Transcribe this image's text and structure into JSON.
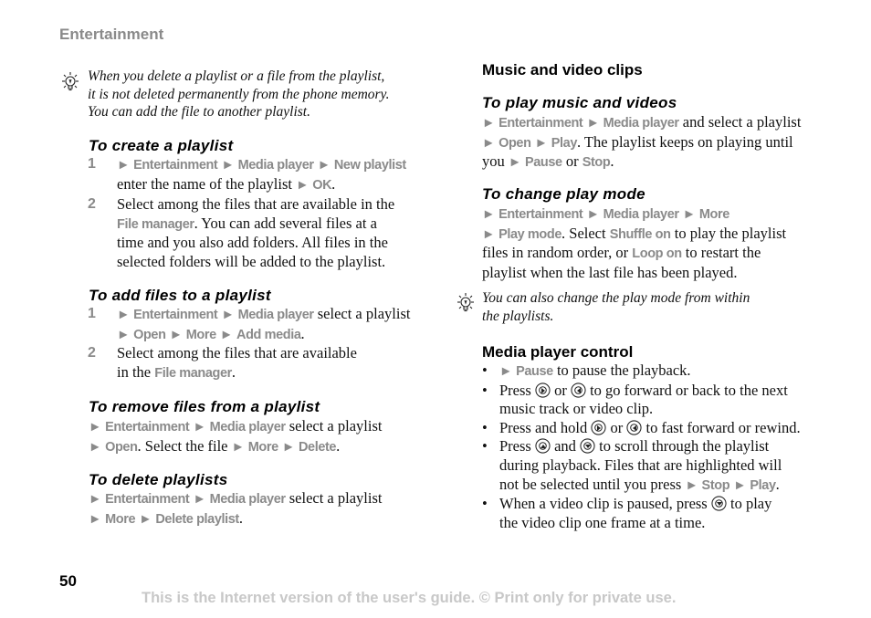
{
  "header": {
    "section": "Entertainment"
  },
  "left": {
    "tip": [
      "When you delete a playlist or a file from the playlist,",
      "it is not deleted permanently from the phone memory.",
      "You can add the file to another playlist."
    ],
    "create": {
      "title": "To create a playlist",
      "step1_num": "1",
      "step1_m1": "Entertainment",
      "step1_m2": "Media player",
      "step1_m3": "New playlist",
      "step1_t1": "enter the name of the playlist",
      "step1_m4": "OK",
      "dot": ".",
      "step2_num": "2",
      "step2_l1": "Select among the files that are available in the",
      "step2_m1": "File manager",
      "step2_l2": ". You can add several files at a",
      "step2_l3": "time and you also add folders. All files in the",
      "step2_l4": "selected folders will be added to the playlist."
    },
    "add": {
      "title": "To add files to a playlist",
      "step1_num": "1",
      "m1": "Entertainment",
      "m2": "Media player",
      "t1": "select a playlist",
      "m3": "Open",
      "m4": "More",
      "m5": "Add media",
      "step2_num": "2",
      "step2_l1": "Select among the files that are available",
      "step2_t": "in the",
      "step2_m": "File manager"
    },
    "remove": {
      "title": "To remove files from a playlist",
      "m1": "Entertainment",
      "m2": "Media player",
      "t1": "select a playlist",
      "m3": "Open",
      "t2": ". Select the file",
      "m4": "More",
      "m5": "Delete"
    },
    "delete": {
      "title": "To delete playlists",
      "m1": "Entertainment",
      "m2": "Media player",
      "t1": "select a playlist",
      "m3": "More",
      "m4": "Delete playlist"
    }
  },
  "right": {
    "section_title": "Music and video clips",
    "play": {
      "title": "To play music and videos",
      "m1": "Entertainment",
      "m2": "Media player",
      "t1": "and select a playlist",
      "m3": "Open",
      "m4": "Play",
      "t2": ". The playlist keeps on playing until",
      "t3": "you",
      "m5": "Pause",
      "t4": "or",
      "m6": "Stop"
    },
    "mode": {
      "title": "To change play mode",
      "m1": "Entertainment",
      "m2": "Media player",
      "m3": "More",
      "m4": "Play mode",
      "t1": ". Select",
      "m5": "Shuffle on",
      "t2": "to play the playlist",
      "t3": "files in random order, or",
      "m6": "Loop on",
      "t4": "to restart the",
      "t5": "playlist when the last file has been played."
    },
    "tip": [
      "You can also change the play mode from within",
      "the playlists."
    ],
    "control": {
      "title": "Media player control",
      "b1_m": "Pause",
      "b1_t": "to pause the playback.",
      "b2_t1": "Press",
      "b2_t2": "or",
      "b2_t3": "to go forward or back to the next",
      "b2_l2": "music track or video clip.",
      "b3_t1": "Press and hold",
      "b3_t2": "or",
      "b3_t3": "to fast forward or rewind.",
      "b4_t1": "Press",
      "b4_t2": "and",
      "b4_t3": "to scroll through the playlist",
      "b4_l2": "during playback. Files that are highlighted will",
      "b4_l3": "not be selected until you press",
      "b4_m1": "Stop",
      "b4_m2": "Play",
      "b5_t1": "When a video clip is paused, press",
      "b5_t2": "to play",
      "b5_l2": "the video clip one frame at a time."
    },
    "bullet": "•",
    "arrow": "►"
  },
  "footer": {
    "page_number": "50",
    "notice": "This is the Internet version of the user's guide. © Print only for private use."
  }
}
